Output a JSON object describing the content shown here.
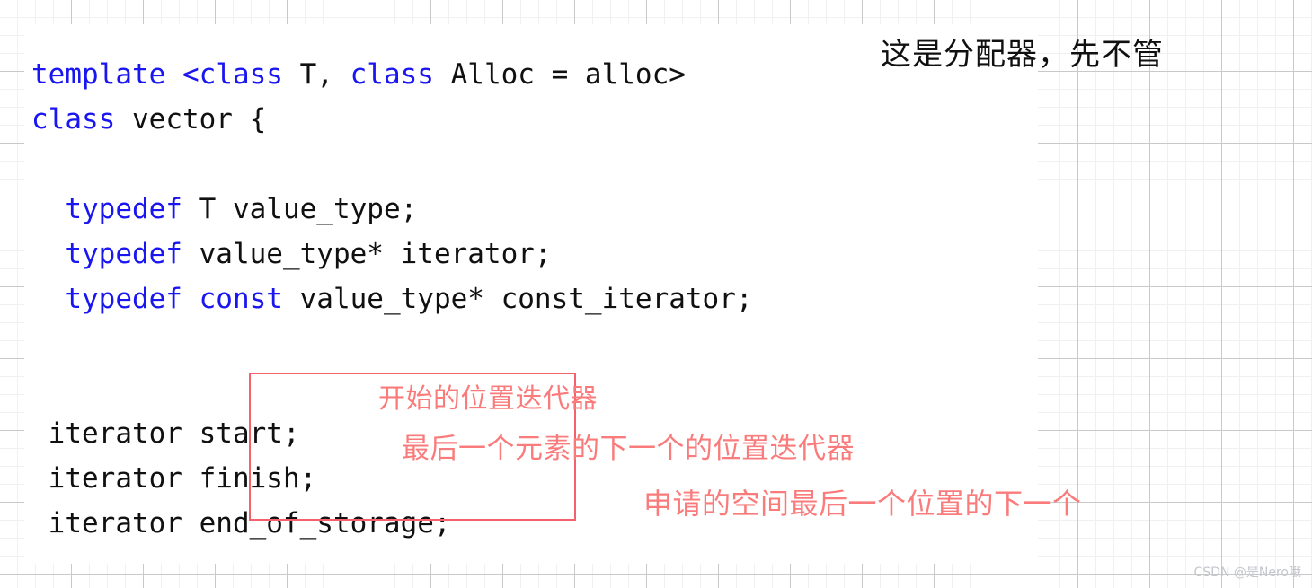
{
  "page": {
    "title": "vector 源码成员结构说明",
    "background": "grid-paper"
  },
  "colors": {
    "keyword": "#1a16f0",
    "code_text": "#101010",
    "annotation_red": "#fa7b7b",
    "box_border": "#f4606c",
    "grid_major": "#c9c9c9",
    "grid_minor": "#f0f0f0",
    "panel": "#ffffff",
    "watermark": "#c3c6cc"
  },
  "code": {
    "language": "cpp",
    "lines": [
      {
        "id": "line-template",
        "segments": [
          {
            "text": "template <class",
            "kind": "keyword"
          },
          {
            "text": " T, ",
            "kind": "plain"
          },
          {
            "text": "class",
            "kind": "keyword"
          },
          {
            "text": " Alloc = alloc>",
            "kind": "plain"
          }
        ]
      },
      {
        "id": "line-class-vector",
        "segments": [
          {
            "text": "class",
            "kind": "keyword"
          },
          {
            "text": " vector {",
            "kind": "plain"
          }
        ]
      },
      {
        "id": "line-blank-1",
        "segments": [
          {
            "text": " ",
            "kind": "plain"
          }
        ]
      },
      {
        "id": "line-typedef-value-type",
        "segments": [
          {
            "text": "  ",
            "kind": "plain"
          },
          {
            "text": "typedef",
            "kind": "keyword"
          },
          {
            "text": " T value_type;",
            "kind": "plain"
          }
        ]
      },
      {
        "id": "line-typedef-iterator",
        "segments": [
          {
            "text": "  ",
            "kind": "plain"
          },
          {
            "text": "typedef",
            "kind": "keyword"
          },
          {
            "text": " value_type* iterator;",
            "kind": "plain"
          }
        ]
      },
      {
        "id": "line-typedef-const-iterator",
        "segments": [
          {
            "text": "  ",
            "kind": "plain"
          },
          {
            "text": "typedef const",
            "kind": "keyword"
          },
          {
            "text": " value_type* const_iterator;",
            "kind": "plain"
          }
        ]
      },
      {
        "id": "line-blank-2",
        "segments": [
          {
            "text": " ",
            "kind": "plain"
          }
        ]
      },
      {
        "id": "line-blank-3",
        "segments": [
          {
            "text": " ",
            "kind": "plain"
          }
        ]
      },
      {
        "id": "line-member-start",
        "segments": [
          {
            "text": " iterator start;",
            "kind": "plain"
          }
        ]
      },
      {
        "id": "line-member-finish",
        "segments": [
          {
            "text": " iterator finish;",
            "kind": "plain"
          }
        ]
      },
      {
        "id": "line-member-end-of-storage",
        "segments": [
          {
            "text": " iterator end_of_storage;",
            "kind": "plain"
          }
        ]
      }
    ]
  },
  "annotations": {
    "allocator": "这是分配器，先不管",
    "start": "开始的位置迭代器",
    "finish": "最后一个元素的下一个的位置迭代器",
    "end_of_storage": "申请的空间最后一个位置的下一个"
  },
  "highlight_box": {
    "name": "member-variables-box",
    "covers": [
      "start;",
      "finish;",
      "end_of_storage;"
    ]
  },
  "watermark": {
    "text": "CSDN @是Nero哦"
  }
}
